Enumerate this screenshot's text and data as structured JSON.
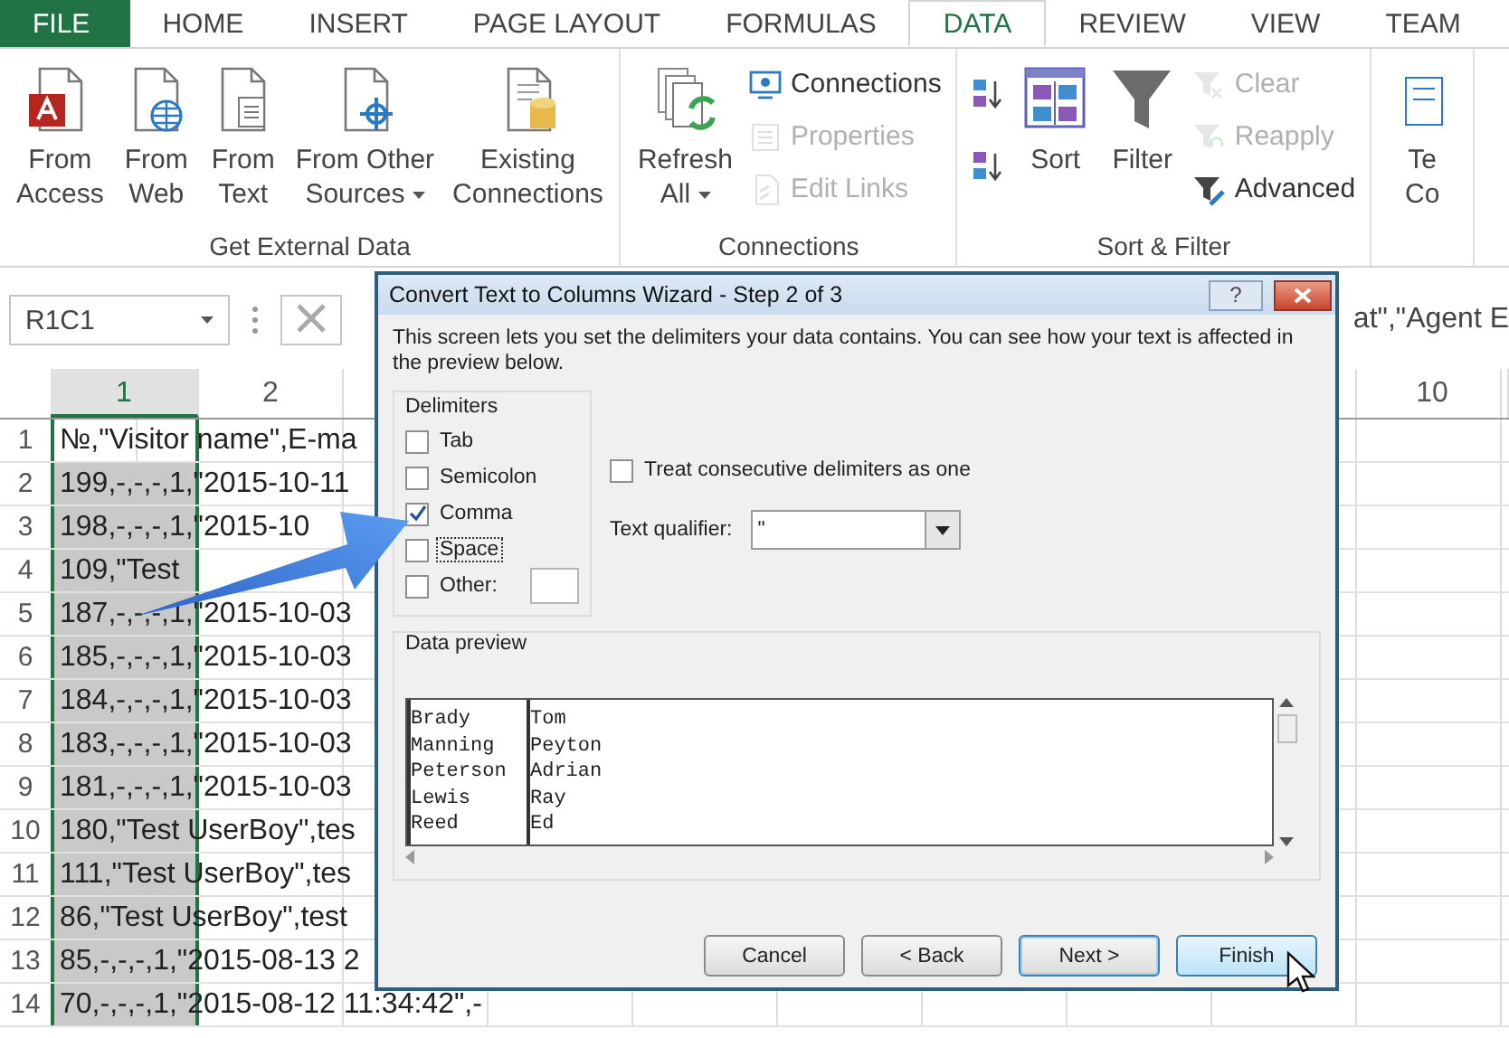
{
  "ribbon_tabs": [
    {
      "label": "FILE",
      "kind": "file",
      "selected": false
    },
    {
      "label": "HOME",
      "kind": "tab",
      "selected": false
    },
    {
      "label": "INSERT",
      "kind": "tab",
      "selected": false
    },
    {
      "label": "PAGE LAYOUT",
      "kind": "tab",
      "selected": false
    },
    {
      "label": "FORMULAS",
      "kind": "tab",
      "selected": false
    },
    {
      "label": "DATA",
      "kind": "tab",
      "selected": true
    },
    {
      "label": "REVIEW",
      "kind": "tab",
      "selected": false
    },
    {
      "label": "VIEW",
      "kind": "tab",
      "selected": false
    },
    {
      "label": "TEAM",
      "kind": "tab",
      "selected": false
    }
  ],
  "ribbon_groups": [
    {
      "label": "Get External Data",
      "items": [
        {
          "kind": "large",
          "lines": [
            "From",
            "Access"
          ],
          "dropdown": false,
          "disabled": false
        },
        {
          "kind": "large",
          "lines": [
            "From",
            "Web"
          ],
          "dropdown": false,
          "disabled": false
        },
        {
          "kind": "large",
          "lines": [
            "From",
            "Text"
          ],
          "dropdown": false,
          "disabled": false
        },
        {
          "kind": "large",
          "lines": [
            "From Other",
            "Sources"
          ],
          "dropdown": true,
          "disabled": false
        },
        {
          "kind": "large",
          "lines": [
            "Existing",
            "Connections"
          ],
          "dropdown": false,
          "disabled": false
        }
      ]
    },
    {
      "label": "Connections",
      "items": [
        {
          "kind": "large",
          "lines": [
            "Refresh",
            "All"
          ],
          "dropdown": true,
          "disabled": false
        },
        {
          "kind": "small",
          "label": "Connections",
          "disabled": false
        },
        {
          "kind": "small",
          "label": "Properties",
          "disabled": true
        },
        {
          "kind": "small",
          "label": "Edit Links",
          "disabled": true
        }
      ]
    },
    {
      "label": "Sort & Filter",
      "items": [
        {
          "kind": "icon",
          "disabled": false
        },
        {
          "kind": "icon",
          "disabled": false
        },
        {
          "kind": "large",
          "lines": [
            "Sort"
          ],
          "dropdown": false,
          "disabled": false
        },
        {
          "kind": "large",
          "lines": [
            "Filter"
          ],
          "dropdown": false,
          "disabled": false
        },
        {
          "kind": "small",
          "label": "Clear",
          "disabled": true
        },
        {
          "kind": "small",
          "label": "Reapply",
          "disabled": true
        },
        {
          "kind": "small",
          "label": "Advanced",
          "disabled": false
        }
      ]
    },
    {
      "items": [
        {
          "kind": "large",
          "lines": [
            "Te",
            "Co"
          ],
          "dropdown": false,
          "disabled": false
        }
      ]
    }
  ],
  "formula_bar": {
    "name_box": "R1C1",
    "formula": "at\",\"Agent E"
  },
  "sheet": {
    "columns": [
      {
        "header": "1",
        "selected": true
      },
      {
        "header": "2",
        "selected": false
      },
      {
        "header": "10",
        "selected": false
      }
    ],
    "rows": [
      {
        "number": "1",
        "text": "№,\"Visitor name\",E-ma",
        "active": true
      },
      {
        "number": "2",
        "text": "199,-,-,-,1,\"2015-10-11",
        "active": false
      },
      {
        "number": "3",
        "text": "198,-,-,-,1,\"2015-10",
        "active": false
      },
      {
        "number": "4",
        "text": "109,\"Test",
        "active": false
      },
      {
        "number": "5",
        "text": "187,-,-,-,1,\"2015-10-03",
        "active": false
      },
      {
        "number": "6",
        "text": "185,-,-,-,1,\"2015-10-03",
        "active": false
      },
      {
        "number": "7",
        "text": "184,-,-,-,1,\"2015-10-03",
        "active": false
      },
      {
        "number": "8",
        "text": "183,-,-,-,1,\"2015-10-03",
        "active": false
      },
      {
        "number": "9",
        "text": "181,-,-,-,1,\"2015-10-03",
        "active": false
      },
      {
        "number": "10",
        "text": "180,\"Test UserBoy\",tes",
        "active": false
      },
      {
        "number": "11",
        "text": "111,\"Test UserBoy\",tes",
        "active": false
      },
      {
        "number": "12",
        "text": "86,\"Test UserBoy\",test",
        "active": false
      },
      {
        "number": "13",
        "text": "85,-,-,-,1,\"2015-08-13 2",
        "active": false
      },
      {
        "number": "14",
        "text": "70,-,-,-,1,\"2015-08-12 11:34:42\",-",
        "active": false
      }
    ]
  },
  "dialog": {
    "title": "Convert Text to Columns Wizard - Step 2 of 3",
    "help": "?",
    "description": "This screen lets you set the delimiters your data contains.  You can see how your text is affected in the preview below.",
    "delimiters_label": "Delimiters",
    "delimiters": [
      {
        "kind": "check",
        "label": "Tab",
        "checked": false,
        "focused": false
      },
      {
        "kind": "check",
        "label": "Semicolon",
        "checked": false,
        "focused": false
      },
      {
        "kind": "check",
        "label": "Comma",
        "checked": true,
        "focused": false
      },
      {
        "kind": "check",
        "label": "Space",
        "checked": false,
        "focused": true
      },
      {
        "kind": "other",
        "label": "Other:",
        "checked": false,
        "focused": false
      }
    ],
    "consecutive": {
      "label": "Treat consecutive delimiters as one",
      "checked": false
    },
    "text_qualifier": {
      "label": "Text qualifier:",
      "value": "\""
    },
    "preview_label": "Data preview",
    "preview_rows": [
      [
        "Brady",
        "Tom"
      ],
      [
        "Manning",
        "Peyton"
      ],
      [
        "Peterson",
        "Adrian"
      ],
      [
        "Lewis",
        "Ray"
      ],
      [
        "Reed",
        "Ed"
      ]
    ],
    "buttons": [
      {
        "label": "Cancel",
        "default": false,
        "hovered": false
      },
      {
        "label": "< Back",
        "default": false,
        "hovered": false
      },
      {
        "label": "Next >",
        "default": true,
        "hovered": false
      },
      {
        "label": "Finish",
        "default": false,
        "hovered": true
      }
    ]
  }
}
